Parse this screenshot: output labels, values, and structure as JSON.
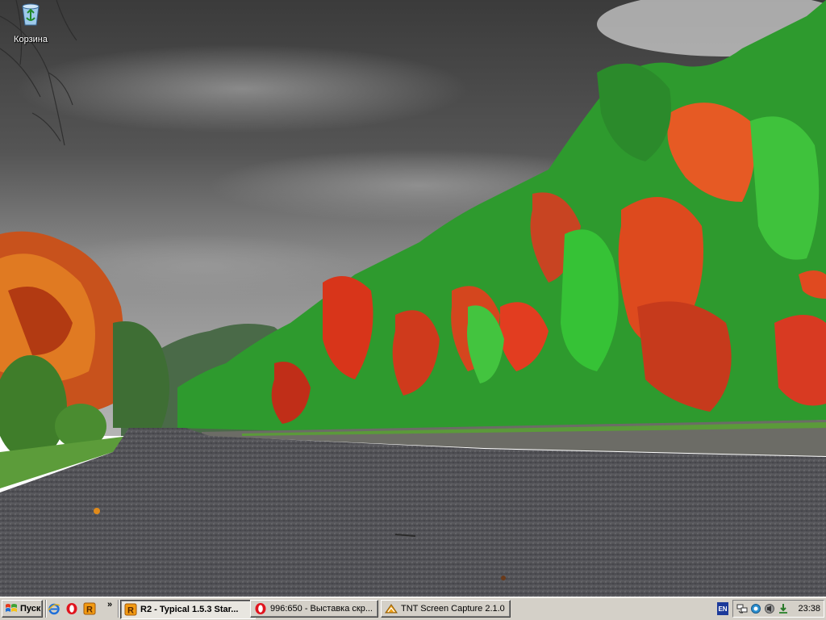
{
  "desktop": {
    "icons": [
      {
        "label": "Корзина",
        "icon": "recycle-bin-icon"
      }
    ]
  },
  "taskbar": {
    "start_label": "Пуск",
    "quick_launch": [
      {
        "icon": "internet-explorer-icon"
      },
      {
        "icon": "opera-icon"
      },
      {
        "icon": "r2-app-icon"
      }
    ],
    "chevron": "»",
    "tasks": [
      {
        "label": "R2 - Typical 1.5.3 Star...",
        "icon": "r2-app-icon",
        "active": true
      },
      {
        "label": "996:650 - Выставка скр...",
        "icon": "opera-icon",
        "active": false
      },
      {
        "label": "TNT Screen Capture 2.1.0",
        "icon": "tnt-capture-icon",
        "active": false
      }
    ],
    "language": "EN",
    "tray_icons": [
      "network-icon",
      "globe-icon",
      "speaker-icon",
      "download-icon"
    ],
    "clock": "23:38"
  },
  "colors": {
    "taskbar_bg": "#d4d0c8",
    "sky_dark": "#3a3a3a",
    "foliage_green": "#2fa82f",
    "foliage_red": "#d83a18"
  }
}
